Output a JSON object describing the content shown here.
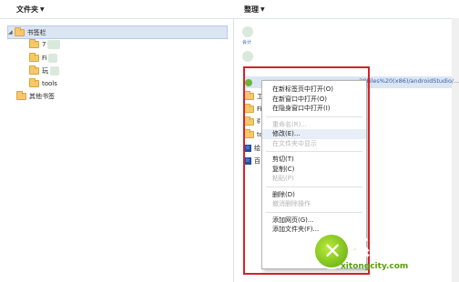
{
  "left_header": {
    "title": "文件夹"
  },
  "right_header": {
    "title": "整理"
  },
  "tree": {
    "bookmarks_bar": "书签栏",
    "children": [
      "7",
      "Fi",
      "玩",
      "tools"
    ],
    "other_bookmarks": "其他书签"
  },
  "right_list": {
    "blurred_label": "会计",
    "url_fragment": "...20Files%20(x86)/androidStudio/...",
    "partial_items": [
      "工",
      "Fi",
      "ह",
      "to",
      "绘",
      "百"
    ]
  },
  "context_menu": {
    "items": [
      {
        "label": "在新标签页中打开(O)",
        "disabled": false
      },
      {
        "label": "在新窗口中打开(O)",
        "disabled": false
      },
      {
        "label": "在隐身窗口中打开(I)",
        "disabled": false
      },
      {
        "separator": true
      },
      {
        "label": "重命名(R)...",
        "disabled": true
      },
      {
        "label": "修改(E)...",
        "disabled": false,
        "hover": true
      },
      {
        "label": "在文件夹中显示",
        "disabled": true
      },
      {
        "separator": true
      },
      {
        "label": "剪切(T)",
        "disabled": false
      },
      {
        "label": "复制(C)",
        "disabled": false
      },
      {
        "label": "粘贴(P)",
        "disabled": true
      },
      {
        "separator": true
      },
      {
        "label": "删除(D)",
        "disabled": false
      },
      {
        "label": "撤消删除操作",
        "disabled": true
      },
      {
        "separator": true
      },
      {
        "label": "添加网页(G)...",
        "disabled": false
      },
      {
        "label": "添加文件夹(F)...",
        "disabled": false
      }
    ]
  },
  "watermark": {
    "title": "系统城",
    "url": "xitongcity.com"
  },
  "colors": {
    "highlight_frame": "#d6212b",
    "selection": "#dbe6f3",
    "watermark": "#7dc112"
  }
}
